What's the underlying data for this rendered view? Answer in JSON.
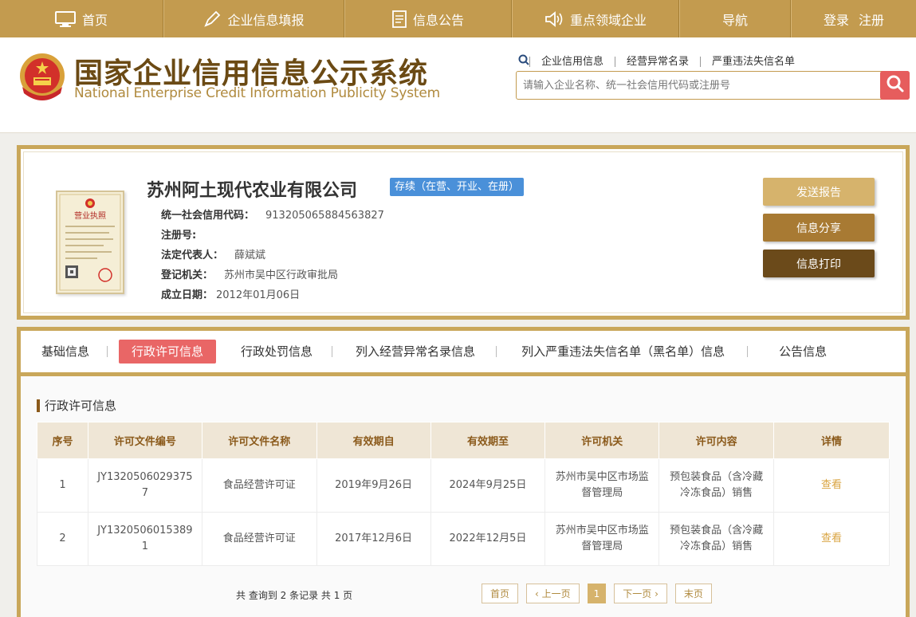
{
  "topnav": [
    {
      "label": "首页",
      "icon": "monitor-icon"
    },
    {
      "label": "企业信息填报",
      "icon": "pen-icon"
    },
    {
      "label": "信息公告",
      "icon": "document-icon"
    },
    {
      "label": "重点领域企业",
      "icon": "speaker-icon"
    },
    {
      "label": "导航",
      "icon": ""
    },
    {
      "login": "登录",
      "register": "注册"
    }
  ],
  "header": {
    "title_cn": "国家企业信用信息公示系统",
    "title_en": "National Enterprise Credit Information Publicity System",
    "search_links": [
      "企业信用信息",
      "经营异常名录",
      "严重违法失信名单"
    ],
    "search_placeholder": "请输入企业名称、统一社会信用代码或注册号"
  },
  "company": {
    "name": "苏州阿土现代农业有限公司",
    "status": "存续（在营、开业、在册）",
    "license_title": "营业执照",
    "fields": [
      {
        "key": "统一社会信用代码：",
        "value": "913205065884563827"
      },
      {
        "key": "注册号:",
        "value": ""
      },
      {
        "key": "法定代表人：",
        "value": "薛斌斌"
      },
      {
        "key": "登记机关：",
        "value": "苏州市吴中区行政审批局"
      },
      {
        "key": "成立日期：",
        "value": "2012年01月06日"
      }
    ],
    "buttons": [
      {
        "label": "发送报告",
        "color": "#d6b36c"
      },
      {
        "label": "信息分享",
        "color": "#a87a33"
      },
      {
        "label": "信息打印",
        "color": "#6b4a1a"
      }
    ]
  },
  "tabs": [
    "基础信息",
    "行政许可信息",
    "行政处罚信息",
    "列入经营异常名录信息",
    "列入严重违法失信名单（黑名单）信息",
    "公告信息"
  ],
  "active_tab": "行政许可信息",
  "section_title": "行政许可信息",
  "table": {
    "headers": [
      "序号",
      "许可文件编号",
      "许可文件名称",
      "有效期自",
      "有效期至",
      "许可机关",
      "许可内容",
      "详情"
    ],
    "rows": [
      [
        "1",
        "JY13205060293757",
        "食品经营许可证",
        "2019年9月26日",
        "2024年9月25日",
        "苏州市吴中区市场监督管理局",
        "预包装食品（含冷藏冷冻食品）销售",
        "查看"
      ],
      [
        "2",
        "JY13205060153891",
        "食品经营许可证",
        "2017年12月6日",
        "2022年12月5日",
        "苏州市吴中区市场监督管理局",
        "预包装食品（含冷藏冷冻食品）销售",
        "查看"
      ]
    ]
  },
  "footer": {
    "summary": "共 查询到 2 条记录 共 1 页",
    "pager": {
      "first": "首页",
      "prev": "‹ 上一页",
      "current": "1",
      "next": "下一页 ›",
      "last": "末页"
    }
  },
  "colors": {
    "nav": "#c39b4f",
    "accent_red": "#e96666",
    "badge_blue": "#4a90d9"
  }
}
